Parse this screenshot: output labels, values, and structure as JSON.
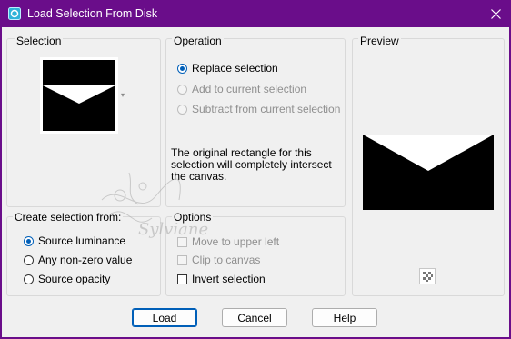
{
  "window": {
    "title": "Load Selection From Disk"
  },
  "titlebar": {
    "app_icon": "paint-shop-app-icon",
    "close_icon": "close-icon"
  },
  "selection": {
    "label": "Selection"
  },
  "operation": {
    "label": "Operation",
    "options": [
      {
        "label": "Replace selection",
        "selected": true,
        "enabled": true
      },
      {
        "label": "Add to current selection",
        "selected": false,
        "enabled": false
      },
      {
        "label": "Subtract from current selection",
        "selected": false,
        "enabled": false
      }
    ],
    "info": "The original rectangle for this selection will completely intersect the canvas."
  },
  "preview": {
    "label": "Preview",
    "toggle_icon": "checkerboard-icon"
  },
  "create_from": {
    "label": "Create selection from:",
    "options": [
      {
        "label": "Source luminance",
        "selected": true
      },
      {
        "label": "Any non-zero value",
        "selected": false
      },
      {
        "label": "Source opacity",
        "selected": false
      }
    ]
  },
  "options": {
    "label": "Options",
    "items": [
      {
        "label": "Move to upper left",
        "checked": false,
        "enabled": false
      },
      {
        "label": "Clip to canvas",
        "checked": false,
        "enabled": false
      },
      {
        "label": "Invert selection",
        "checked": false,
        "enabled": true
      }
    ]
  },
  "buttons": {
    "load": "Load",
    "cancel": "Cancel",
    "help": "Help"
  },
  "watermark": {
    "text": "Sylviane"
  },
  "colors": {
    "titlebar": "#6a0d8a",
    "accent": "#005fb8",
    "client": "#f0f0f0"
  }
}
